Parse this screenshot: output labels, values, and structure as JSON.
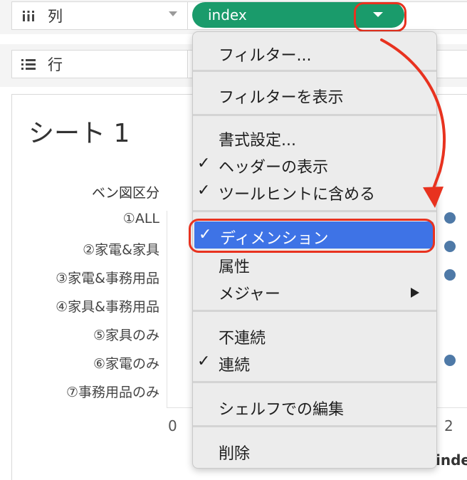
{
  "shelves": {
    "columns_label": "列",
    "rows_label": "行",
    "pill_label": "index"
  },
  "sheet": {
    "title": "シート 1",
    "row_header": "ベン図区分",
    "rows": [
      "①ALL",
      "②家電&家具",
      "③家電&事務用品",
      "④家具&事務用品",
      "⑤家具のみ",
      "⑥家電のみ",
      "⑦事務用品のみ"
    ],
    "axis_ticks": [
      "0",
      "2"
    ],
    "axis_label": "index",
    "points_present": [
      true,
      true,
      true,
      false,
      false,
      true,
      false
    ]
  },
  "menu": {
    "filter": "フィルター...",
    "show_filter": "フィルターを表示",
    "format": "書式設定...",
    "show_header": "ヘッダーの表示",
    "include_tooltip": "ツールヒントに含める",
    "dimension": "ディメンション",
    "attribute": "属性",
    "measure": "メジャー",
    "discrete": "不連続",
    "continuous": "連続",
    "edit_in_shelf": "シェルフでの編集",
    "remove": "削除",
    "checkmark": "✓"
  },
  "colors": {
    "pill": "#1a9b6b",
    "highlight": "#3e73e6",
    "annotation": "#e8321f",
    "mark": "#4e79a7"
  }
}
